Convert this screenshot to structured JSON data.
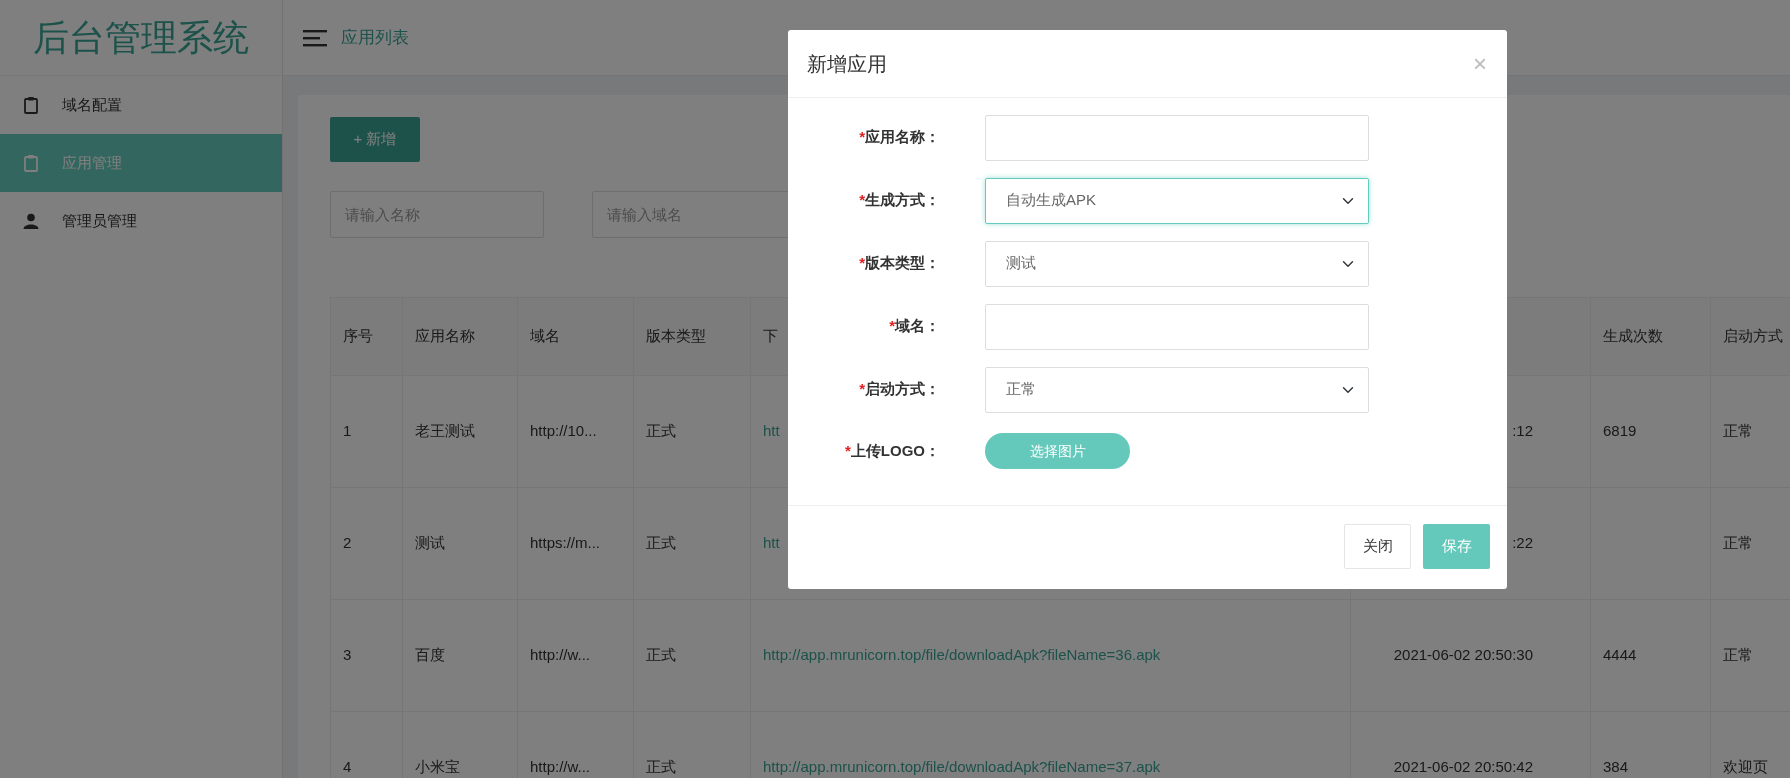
{
  "sidebar": {
    "logo": "后台管理系统",
    "items": [
      {
        "label": "域名配置",
        "selected": false,
        "kind": "clipboard"
      },
      {
        "label": "应用管理",
        "selected": true,
        "kind": "clipboard"
      },
      {
        "label": "管理员管理",
        "selected": false,
        "kind": "person"
      }
    ]
  },
  "topbar": {
    "title": "应用列表"
  },
  "toolbar": {
    "add_button": "+ 新增"
  },
  "filters": [
    {
      "placeholder": "请输入名称"
    },
    {
      "placeholder": "请输入域名"
    }
  ],
  "table": {
    "columns": {
      "no": "序号",
      "name": "应用名称",
      "domain": "域名",
      "version": "版本类型",
      "download": "下",
      "count": "生成次数",
      "launch": "启动方式"
    },
    "rows": [
      {
        "no": "1",
        "name": "老王测试",
        "domain": "http://10...",
        "version": "正式",
        "download": "htt",
        "time": ":12",
        "count": "6819",
        "launch": "正常"
      },
      {
        "no": "2",
        "name": "测试",
        "domain": "https://m...",
        "version": "正式",
        "download": "htt",
        "time": ":22",
        "launch": "正常"
      },
      {
        "no": "3",
        "name": "百度",
        "domain": "http://w...",
        "version": "正式",
        "download": "http://app.mrunicorn.top/file/downloadApk?fileName=36.apk",
        "time": "2021-06-02 20:50:30",
        "count": "4444",
        "launch": "正常"
      },
      {
        "no": "4",
        "name": "小米宝",
        "domain": "http://w...",
        "version": "正式",
        "download": "http://app.mrunicorn.top/file/downloadApk?fileName=37.apk",
        "time": "2021-06-02 20:50:42",
        "count": "384",
        "launch": "欢迎页"
      }
    ]
  },
  "modal": {
    "title": "新增应用",
    "close": "×",
    "fields": [
      {
        "mark": "*",
        "label": "应用名称：",
        "kind": "text",
        "focused": false
      },
      {
        "mark": "*",
        "label": "生成方式：",
        "kind": "select",
        "value": "自动生成APK",
        "focused": true
      },
      {
        "mark": "*",
        "label": "版本类型：",
        "kind": "select",
        "value": "测试",
        "focused": false
      },
      {
        "mark": "*",
        "label": "域名：",
        "kind": "text",
        "focused": false
      },
      {
        "mark": "*",
        "label": "启动方式：",
        "kind": "select",
        "value": "正常",
        "focused": false
      },
      {
        "mark": "*",
        "label": "上传LOGO：",
        "kind": "upload",
        "button": "选择图片"
      }
    ],
    "buttons": [
      {
        "label": "关闭",
        "kind": "default"
      },
      {
        "label": "保存",
        "kind": "primary"
      }
    ]
  }
}
